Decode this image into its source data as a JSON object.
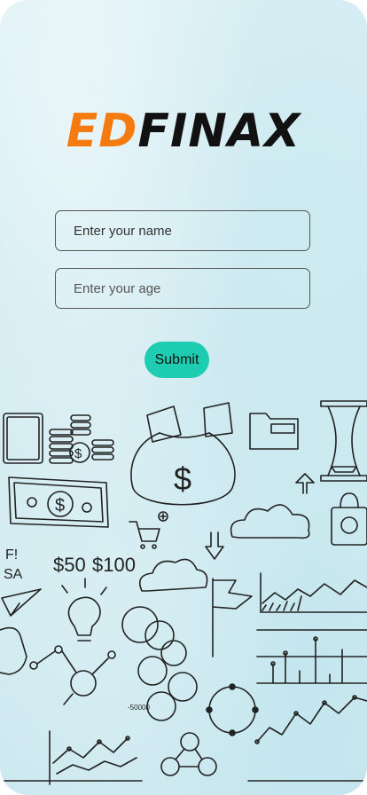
{
  "app": {
    "logo_part1": "ED",
    "logo_part2": "FINAX"
  },
  "form": {
    "name_placeholder": "Enter your name",
    "age_placeholder": "Enter your age",
    "submit_label": "Submit"
  },
  "colors": {
    "logo_accent": "#f57a10",
    "submit_bg": "#1ecdb1"
  },
  "illustration": {
    "price_a": "$50",
    "price_b": "$100",
    "sale_text": "SA"
  }
}
